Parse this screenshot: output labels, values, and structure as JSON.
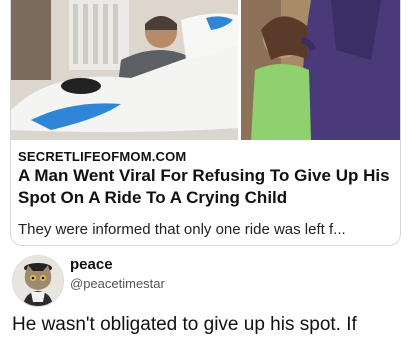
{
  "card": {
    "domain": "SECRETLIFEOFMOM.COM",
    "headline": "A Man Went Viral For Refusing To Give Up His Spot On A Ride To A Crying Child",
    "description": "They were informed that only one ride was left f..."
  },
  "author": {
    "name": "peace",
    "handle": "@peacetimestar"
  },
  "post": {
    "text": "He wasn't obligated to give up his spot. If"
  },
  "icons": [
    "cat-avatar-icon"
  ]
}
